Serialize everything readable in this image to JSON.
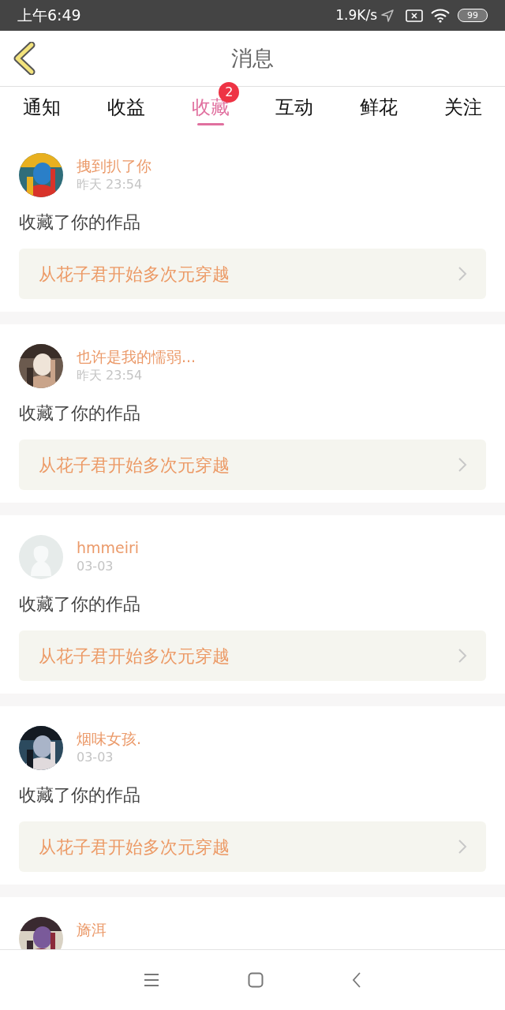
{
  "status_bar": {
    "time": "上午6:49",
    "speed": "1.9K/s",
    "battery": "99"
  },
  "header": {
    "title": "消息"
  },
  "tabs": [
    {
      "label": "通知",
      "selected": false
    },
    {
      "label": "收益",
      "selected": false
    },
    {
      "label": "收藏",
      "selected": true,
      "badge": "2"
    },
    {
      "label": "互动",
      "selected": false
    },
    {
      "label": "鲜花",
      "selected": false
    },
    {
      "label": "关注",
      "selected": false
    }
  ],
  "messages": [
    {
      "name": "拽到扒了你",
      "time": "昨天 23:54",
      "action": "收藏了你的作品",
      "work": "从花子君开始多次元穿越"
    },
    {
      "name": "也许是我的懦弱...",
      "time": "昨天 23:54",
      "action": "收藏了你的作品",
      "work": "从花子君开始多次元穿越"
    },
    {
      "avatar": {
        "kind": "default"
      },
      "name": "hmmeiri",
      "time": "03-03",
      "action": "收藏了你的作品",
      "work": "从花子君开始多次元穿越"
    },
    {
      "name": "烟味女孩.",
      "time": "03-03",
      "action": "收藏了你的作品",
      "work": "从花子君开始多次元穿越"
    },
    {
      "name": "旖洱"
    }
  ]
}
